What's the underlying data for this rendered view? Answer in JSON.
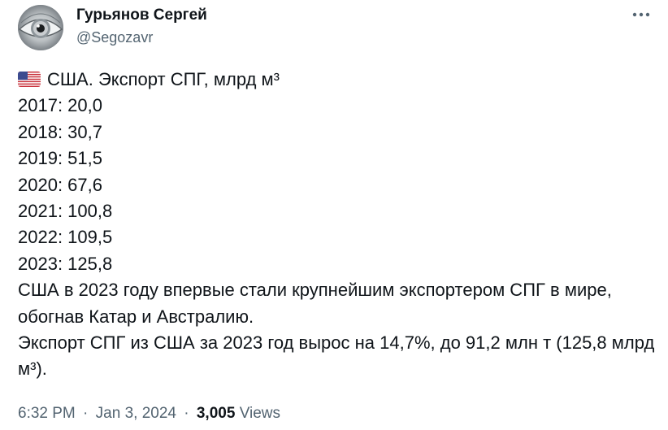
{
  "author": {
    "name": "Гурьянов Сергей",
    "handle": "@Segozavr"
  },
  "tweet": {
    "title_line": "США. Экспорт СПГ, млрд м³",
    "data_lines": [
      "2017: 20,0",
      "2018: 30,7",
      "2019: 51,5",
      "2020: 67,6",
      "2021: 100,8",
      "2022: 109,5",
      "2023: 125,8"
    ],
    "paragraph_1": "США в 2023 году впервые стали крупнейшим экспортером СПГ в мире, обогнав Катар и Австралию.",
    "paragraph_2": "Экспорт СПГ из США за 2023 год вырос на 14,7%, до 91,2 млн т (125,8 млрд м³)."
  },
  "meta": {
    "time": "6:32 PM",
    "separator": "·",
    "date": "Jan 3, 2024",
    "views_count": "3,005",
    "views_label": "Views"
  },
  "icons": {
    "avatar": "eye-avatar-image",
    "flag": "us-flag-icon",
    "more": "more-options-icon"
  },
  "colors": {
    "text": "#0f1419",
    "secondary_text": "#536471",
    "background": "#ffffff"
  }
}
